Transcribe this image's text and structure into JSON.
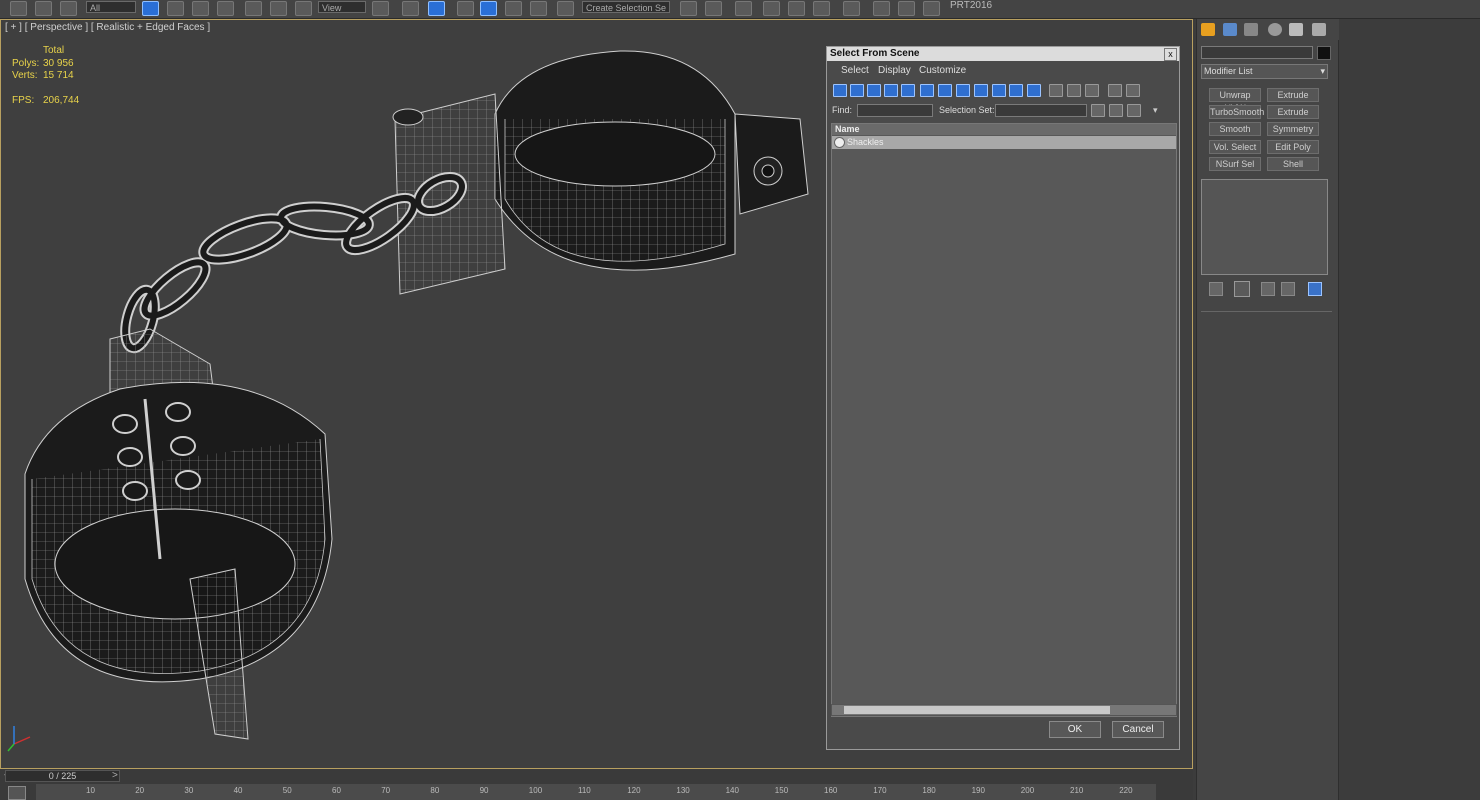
{
  "app": {
    "build_label": "PRT2016"
  },
  "toolbar": {
    "selection_filter": "All",
    "reference_coord": "View",
    "named_selection_placeholder": "Create Selection Se"
  },
  "viewport": {
    "label": "[ + ] [ Perspective ] [ Realistic + Edged Faces ]",
    "stats": {
      "total_label": "Total",
      "polys_label": "Polys:",
      "polys_value": "30 956",
      "verts_label": "Verts:",
      "verts_value": "15 714",
      "fps_label": "FPS:",
      "fps_value": "206,744"
    }
  },
  "dialog": {
    "title": "Select From Scene",
    "close": "x",
    "menus": [
      "Select",
      "Display",
      "Customize"
    ],
    "find_label": "Find:",
    "find_value": "",
    "selection_set_label": "Selection Set:",
    "selection_set_value": "",
    "column_header": "Name",
    "rows": [
      {
        "name": "Shackles"
      }
    ],
    "ok_label": "OK",
    "cancel_label": "Cancel"
  },
  "command_panel": {
    "name_field": "",
    "modifier_list_label": "Modifier List",
    "modifier_buttons": [
      [
        "Unwrap UVW",
        "Extrude"
      ],
      [
        "TurboSmooth",
        "Extrude"
      ],
      [
        "Smooth",
        "Symmetry"
      ],
      [
        "Vol. Select",
        "Edit Poly"
      ],
      [
        "NSurf Sel",
        "Shell"
      ]
    ]
  },
  "timeline": {
    "frame_readout": "0 / 225",
    "tick_labels": [
      "10",
      "20",
      "30",
      "40",
      "50",
      "60",
      "70",
      "80",
      "90",
      "100",
      "110",
      "120",
      "130",
      "140",
      "150",
      "160",
      "170",
      "180",
      "190",
      "200",
      "210",
      "220"
    ]
  },
  "colors": {
    "accent": "#2f6fd0",
    "viewport_border": "#b8a060",
    "stats_text": "#e8d34a",
    "wireframe": "#cfcfcf"
  }
}
